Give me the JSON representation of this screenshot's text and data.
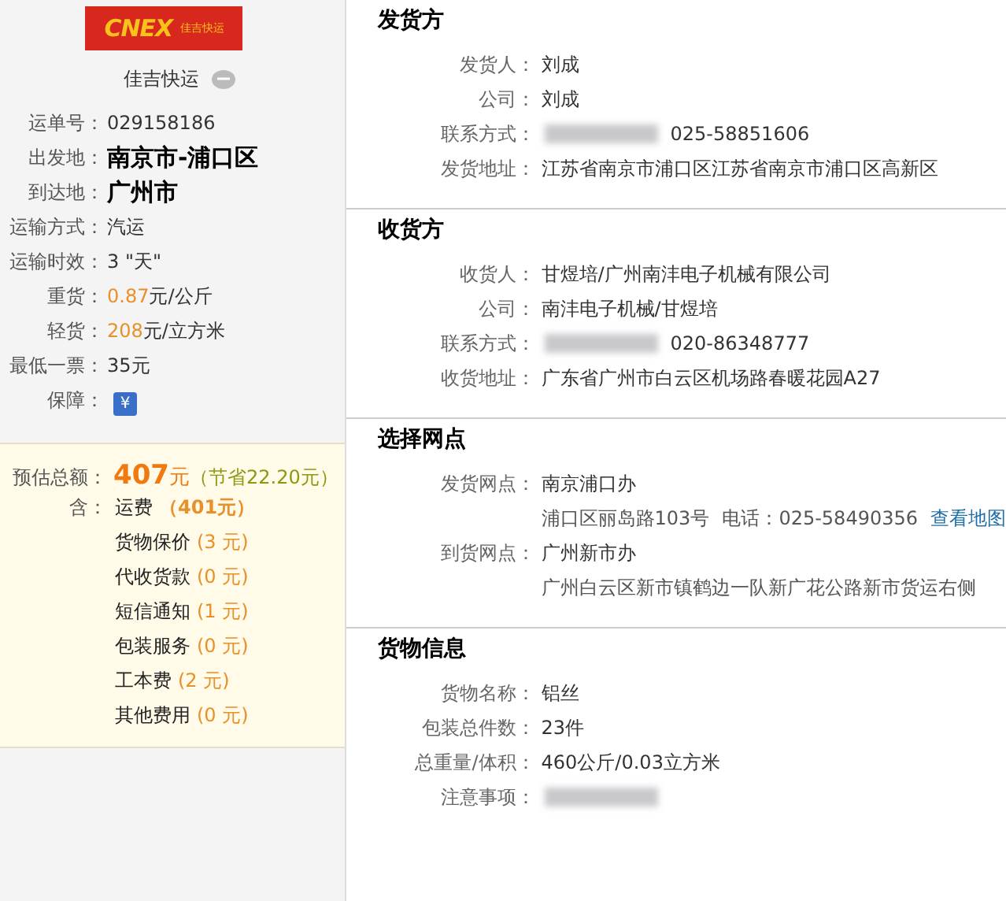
{
  "carrier": {
    "logo": {
      "brand": "CNEX",
      "tagline": "佳吉快运"
    },
    "name": "佳吉快运"
  },
  "waybill": [
    {
      "label": "运单号：",
      "value": "029158186",
      "kind": "plain"
    },
    {
      "label": "出发地：",
      "value": "南京市-浦口区",
      "kind": "bold"
    },
    {
      "label": "到达地：",
      "value": "广州市",
      "kind": "bold"
    },
    {
      "label": "运输方式：",
      "value": "汽运",
      "kind": "plain"
    },
    {
      "label": "运输时效：",
      "value": "3 \"天\"",
      "kind": "plain"
    },
    {
      "label": "重货：",
      "value": "0.87",
      "unit": "元/公斤",
      "kind": "price"
    },
    {
      "label": "轻货：",
      "value": "208",
      "unit": "元/立方米",
      "kind": "price"
    },
    {
      "label": "最低一票：",
      "value": "35元",
      "kind": "plain"
    },
    {
      "label": "保障：",
      "value": "¥",
      "kind": "badge"
    }
  ],
  "estimate": {
    "label": "预估总额：",
    "total": "407",
    "unit": "元",
    "saving": "（节省22.20元）",
    "includes_label": "含：",
    "items": [
      {
        "name": "运费",
        "amount": "（401元）",
        "kind": "main"
      },
      {
        "name": "货物保价",
        "amount": "(3 元)",
        "kind": "extra"
      },
      {
        "name": "代收货款",
        "amount": "(0 元)",
        "kind": "extra"
      },
      {
        "name": "短信通知",
        "amount": "(1 元)",
        "kind": "extra"
      },
      {
        "name": "包装服务",
        "amount": "(0 元)",
        "kind": "extra"
      },
      {
        "name": "工本费",
        "amount": "(2 元)",
        "kind": "extra"
      },
      {
        "name": "其他费用",
        "amount": "(0 元)",
        "kind": "extra"
      }
    ]
  },
  "sections": [
    {
      "title": "发货方",
      "fields": [
        {
          "label": "发货人：",
          "value": "刘成",
          "kind": "plain"
        },
        {
          "label": "公司：",
          "value": "刘成",
          "kind": "plain"
        },
        {
          "label": "联系方式：",
          "value": "025-58851606",
          "kind": "redacted"
        },
        {
          "label": "发货地址：",
          "value": "江苏省南京市浦口区江苏省南京市浦口区高新区",
          "kind": "plain"
        }
      ]
    },
    {
      "title": "收货方",
      "fields": [
        {
          "label": "收货人：",
          "value": "甘煜培/广州南沣电子机械有限公司",
          "kind": "plain"
        },
        {
          "label": "公司：",
          "value": "南沣电子机械/甘煜培",
          "kind": "plain"
        },
        {
          "label": "联系方式：",
          "value": "020-86348777",
          "kind": "redacted"
        },
        {
          "label": "收货地址：",
          "value": "广东省广州市白云区机场路春暖花园A27",
          "kind": "plain"
        }
      ]
    },
    {
      "title": "选择网点",
      "fields": [
        {
          "label": "发货网点：",
          "value": "南京浦口办",
          "kind": "plain",
          "detail": "浦口区丽岛路103号",
          "phone": "电话：025-58490356",
          "link": "查看地图"
        },
        {
          "label": "到货网点：",
          "value": "广州新市办",
          "kind": "plain",
          "detail": "广州白云区新市镇鹤边一队新广花公路新市货运右侧"
        }
      ]
    },
    {
      "title": "货物信息",
      "fields": [
        {
          "label": "货物名称：",
          "value": "铝丝",
          "kind": "plain"
        },
        {
          "label": "包装总件数：",
          "value": "23件",
          "kind": "plain"
        },
        {
          "label": "总重量/体积：",
          "value": "460公斤/0.03立方米",
          "kind": "plain"
        },
        {
          "label": "注意事项：",
          "kind": "redacted"
        }
      ]
    }
  ]
}
